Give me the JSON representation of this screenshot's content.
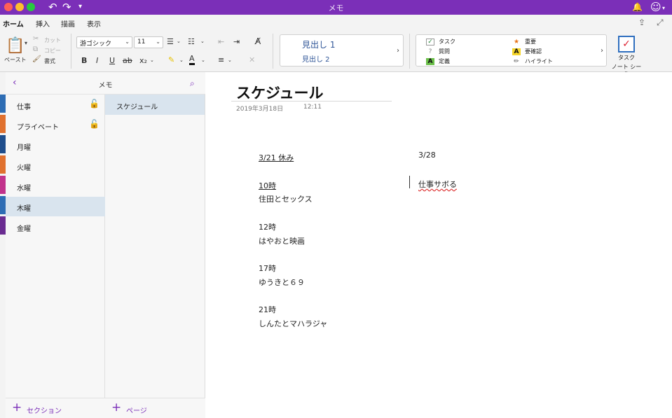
{
  "window": {
    "title": "メモ"
  },
  "ribbon_tabs": [
    "ホーム",
    "挿入",
    "描画",
    "表示"
  ],
  "clipboard": {
    "paste": "ペースト",
    "cut": "カット",
    "copy": "コピー",
    "format": "書式"
  },
  "font": {
    "family": "游ゴシック",
    "size": "11"
  },
  "styles": {
    "heading1": "見出し 1",
    "heading2": "見出し 2"
  },
  "tags": {
    "task": "タスク",
    "question": "質問",
    "definition": "定義",
    "important": "重要",
    "check": "要確認",
    "highlight": "ハイライト"
  },
  "task_button": {
    "line1": "タスク",
    "line2": "ノート シール"
  },
  "notebook": {
    "title": "メモ"
  },
  "sections": [
    {
      "label": "仕事",
      "locked": true,
      "color": "#2E6DB4"
    },
    {
      "label": "プライベート",
      "locked": true,
      "color": "#E0712F"
    },
    {
      "label": "月曜",
      "locked": false,
      "color": "#1F4E8C"
    },
    {
      "label": "火曜",
      "locked": false,
      "color": "#E0712F"
    },
    {
      "label": "水曜",
      "locked": false,
      "color": "#C2338C"
    },
    {
      "label": "木曜",
      "locked": false,
      "color": "#2E6DB4"
    },
    {
      "label": "金曜",
      "locked": false,
      "color": "#6A2C91"
    }
  ],
  "selected_section": 5,
  "pages": [
    {
      "label": "スケジュール"
    }
  ],
  "footer": {
    "add_section": "セクション",
    "add_page": "ページ"
  },
  "note": {
    "title": "スケジュール",
    "date": "2019年3月18日",
    "time": "12:11",
    "left_column": [
      "3/21 休み",
      "10時",
      "住田とセックス",
      "12時",
      "はやおと映画",
      "17時",
      "ゆうきと６９",
      "21時",
      "しんたとマハラジャ"
    ],
    "right_column": [
      "3/28",
      "仕事サボる"
    ]
  },
  "colors": {
    "accent": "#7B2FB8",
    "heading": "#2F5597"
  }
}
